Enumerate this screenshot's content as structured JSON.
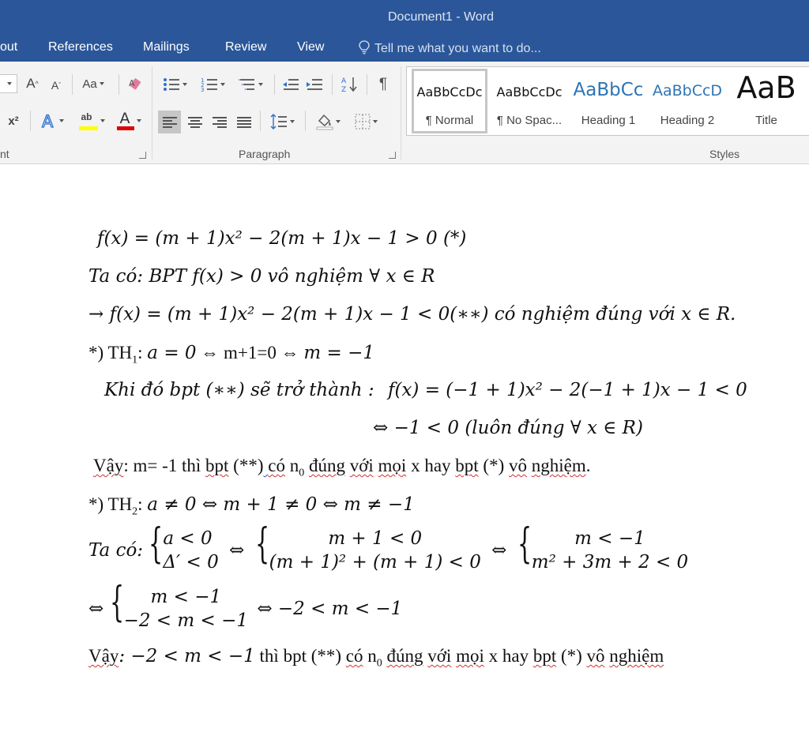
{
  "window": {
    "title": "Document1 - Word"
  },
  "tabs": {
    "layout_partial": "out",
    "references": "References",
    "mailings": "Mailings",
    "review": "Review",
    "view": "View",
    "tell_me": "Tell me what you want to do..."
  },
  "ribbon": {
    "font_group_label": "nt",
    "paragraph_group_label": "Paragraph",
    "styles_group_label": "Styles",
    "change_case": "Aa",
    "superscript": "x²",
    "styles": [
      {
        "sample": "AaBbCcDc",
        "name": "¶ Normal"
      },
      {
        "sample": "AaBbCcDc",
        "name": "¶ No Spac..."
      },
      {
        "sample": "AaBbCc",
        "name": "Heading 1"
      },
      {
        "sample": "AaBbCcD",
        "name": "Heading 2"
      },
      {
        "sample": "AaB",
        "name": "Title"
      }
    ],
    "colors": {
      "highlight": "#ffff00",
      "font_color": "#e00000"
    }
  },
  "document": {
    "l1": "f(x) = (m + 1)x² − 2(m + 1)x − 1  > 0  (*)",
    "l2": "Ta có: BPT f(x)  > 0 vô nghiệm ∀ x ∈ R",
    "l3": "→ f(x) = (m + 1)x² − 2(m + 1)x − 1  < 0(∗∗) có nghiệm đúng với x  ∈ R.",
    "l4_prefix": "*) TH",
    "l4_sub": "1",
    "l4_a": ": ",
    "l4_math1": "a = 0",
    "l4_b": " ⇔ m+1=0 ⇔ ",
    "l4_math2": "m = −1",
    "l5a": "Khi đó bpt (∗∗) sẽ trở thành :",
    "l5b": "f(x) = (−1 + 1)x² − 2(−1 + 1)x − 1  < 0",
    "l6": "⇔ −1  < 0 (luôn đúng ∀ x ∈ R)",
    "l7_vay": "Vậy",
    "l7_a": ": m= -1 thì ",
    "l7_bpt": "bpt",
    "l7_b": " (**)",
    "l7_c": "  ",
    "l7_co": "có",
    "l7_d": " n",
    "l7_sub": "0",
    "l7_e": " ",
    "l7_dung": "đúng",
    "l7_f": " ",
    "l7_voi": "với",
    "l7_g": " ",
    "l7_moi": "mọi",
    "l7_h": " x  hay ",
    "l7_bpt2": "bpt",
    "l7_i": " (*) ",
    "l7_vo": "vô",
    "l7_j": " ",
    "l7_nghiem": "nghiệm",
    "l7_k": ".",
    "l8_prefix": "*) TH",
    "l8_sub": "2",
    "l8_a": ": ",
    "l8_math": "a ≠ 0 ⇔ m + 1 ≠ 0 ⇔ m ≠ −1",
    "l9_taco": "Ta có:",
    "l9_sys1_r1": "a  < 0",
    "l9_sys1_r2": "Δ′  < 0",
    "l9_iff1": "⇔",
    "l9_sys2_r1": "m + 1 < 0",
    "l9_sys2_r2": "(m + 1)² + (m + 1) < 0",
    "l9_iff2": "⇔",
    "l9_sys3_r1": "m < −1",
    "l9_sys3_r2": "m² + 3m + 2 < 0",
    "l10_iff": "⇔",
    "l10_sys_r1": "m < −1",
    "l10_sys_r2": "−2 < m < −1",
    "l10_rest": "⇔ −2 < m < −1",
    "l11_vay": "Vậy",
    "l11_math": ": −2 < m < −1",
    "l11_a": "  thì bpt (**)  ",
    "l11_co": "có",
    "l11_b": " n",
    "l11_sub": "0",
    "l11_c": " ",
    "l11_dung": "đúng",
    "l11_d": " ",
    "l11_voi": "với",
    "l11_e": " ",
    "l11_moi": "mọi",
    "l11_f": " x  hay ",
    "l11_bpt": "bpt",
    "l11_g": " (*) ",
    "l11_vo": "vô",
    "l11_h": " ",
    "l11_nghiem": "nghiệm"
  }
}
